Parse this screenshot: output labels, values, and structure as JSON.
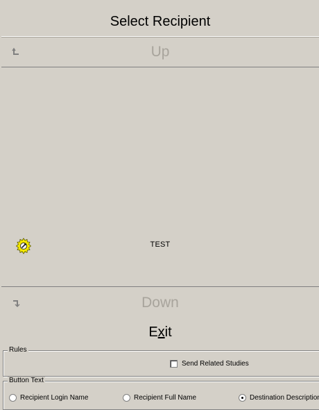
{
  "window": {
    "title": "Select Recipient"
  },
  "nav": {
    "up_label": "Up",
    "down_label": "Down",
    "exit_label_pre": "E",
    "exit_label_mnemonic": "x",
    "exit_label_post": "it"
  },
  "list": {
    "items": [
      {
        "label": "TEST",
        "icon": "gear-icon"
      }
    ]
  },
  "rules": {
    "legend": "Rules",
    "send_related_studies": {
      "label": "Send Related Studies",
      "checked": false
    }
  },
  "button_text": {
    "legend": "Button Text",
    "options": [
      {
        "label": "Recipient Login Name",
        "selected": false
      },
      {
        "label": "Recipient Full Name",
        "selected": false
      },
      {
        "label": "Destination Description",
        "selected": true
      }
    ]
  },
  "colors": {
    "face": "#d4d0c8",
    "disabled_text": "#a8a49c",
    "gear": "#f2e600"
  }
}
